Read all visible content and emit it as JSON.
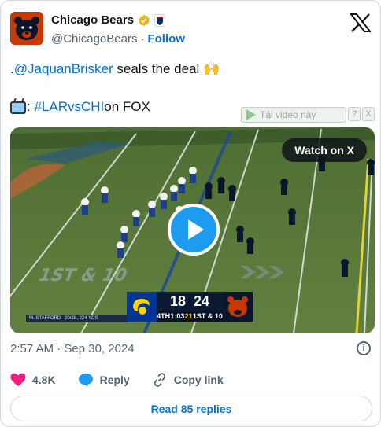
{
  "account": {
    "name": "Chicago Bears",
    "handle": "@ChicagoBears",
    "separator": "·",
    "follow_label": "Follow"
  },
  "tweet": {
    "line1_prefix": ".",
    "line1_mention": "@JaquanBrisker",
    "line1_text": " seals the deal ",
    "line1_emoji": "🙌",
    "line2_colon": ":",
    "line2_hashtag": "#LARvsCHI",
    "line2_text": " on FOX"
  },
  "download_bar": {
    "label": "Tải video này",
    "help": "?",
    "close": "X"
  },
  "video": {
    "watch_label": "Watch on X",
    "field_text": "1ST & 10",
    "scorebug": {
      "away_score": "18",
      "home_score": "24",
      "quarter": "4TH",
      "clock": "1:03",
      "play_clock": "21",
      "down": "1ST & 10"
    },
    "player_bar": "M. STAFFORD",
    "player_stats": "20/28, 224 YDS"
  },
  "timestamp": "2:57 AM · Sep 30, 2024",
  "actions": {
    "likes": "4.8K",
    "reply_label": "Reply",
    "copy_label": "Copy link"
  },
  "read_replies": "Read 85 replies",
  "colors": {
    "link": "#006fd6",
    "heart": "#f91880",
    "play": "#1d9bf0",
    "bears_orange": "#c83803",
    "bears_navy": "#0b162a"
  }
}
